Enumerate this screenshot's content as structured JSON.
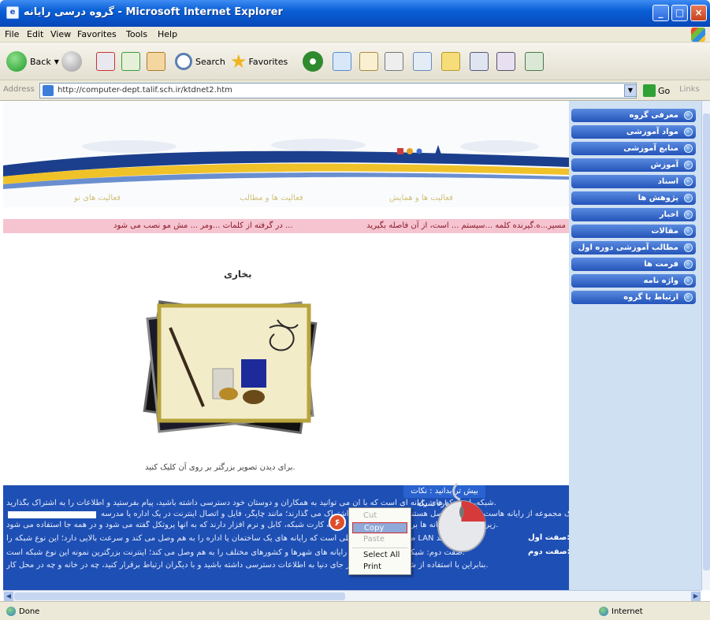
{
  "window": {
    "title": "گروه درسی رایانه - Microsoft Internet Explorer",
    "icon": "ie-page-icon",
    "controls": [
      "minimize",
      "maximize",
      "close"
    ]
  },
  "menubar": [
    "File",
    "Edit",
    "View",
    "Favorites",
    "Tools",
    "Help"
  ],
  "toolbar": {
    "back_label": "Back",
    "search_label": "Search",
    "favorites_label": "Favorites"
  },
  "addressbar": {
    "label": "Address",
    "url": "http://computer-dept.talif.sch.ir/ktdnet2.htm",
    "go_label": "Go",
    "links_label": "Links"
  },
  "banner_links": [
    "فعالیت ها و همایش",
    "فعالیت ها و مطالب",
    "فعالیت های نو"
  ],
  "marquee": {
    "text_right": "مسیر...ه.گیرنده کلمه ...سیستم ... است، از آن فاصله بگیرید",
    "text_left": "در گرفته از کلمات ...ومر ... مش مو نصب می شود ..."
  },
  "heading": "بخاری",
  "caption": "برای دیدن تصویر بزرگتر بر روی آن کلیک کنید.",
  "article": {
    "title": "بیش تر بدانید : نکات مهم درباره شبکه",
    "lines": [
      "شبکه، از شبکه های رایانه ای است که با آن می توانید به همکاران و دوستان خود دسترسی داشته باشید، پیام بفرستید و اطلاعات را به اشتراک بگذارید.",
      "شبکه یک مجموعه از رایانه هاست که به هم متصل هستند و منابع خود را به اشتراک می گذارند؛ مانند چاپگر، فایل و اتصال اینترنت در یک اداره یا مدرسه.",
      "زیر برگ گفت: رایانه ها برای ارتباط با یکدیگر نیاز به کارت شبکه، کابل و نرم افزار دارند که به آنها پروتکل گفته می شود و در همه جا استفاده می شود.",
      "صفت اول: شبکه محلی است که رایانه های یک ساختمان یا اداره را به هم وصل می کند و سرعت بالایی دارد؛ این نوع شبکه را LAN می نامند.",
      "صفت دوم: شبکه گسترده است که رایانه های شهرها و کشورهای مختلف را به هم وصل می کند؛ اینترنت بزرگترین نمونه این نوع شبکه است.",
      "بنابراین با استفاده از شبکه می توانید از هر جای دنیا به اطلاعات دسترسی داشته باشید و با دیگران ارتباط برقرار کنید، چه در خانه و چه در محل کار."
    ],
    "bold_1": "صفت اول:",
    "bold_2": "صفت دوم:"
  },
  "context_menu": {
    "items": [
      {
        "label": "Cut",
        "enabled": false
      },
      {
        "label": "Copy",
        "enabled": true,
        "highlighted": true
      },
      {
        "label": "Paste",
        "enabled": false
      },
      {
        "label": "Select All",
        "enabled": true
      },
      {
        "label": "Print",
        "enabled": true
      }
    ]
  },
  "step_number": "۶",
  "sidebar": {
    "items": [
      "معرفی گروه",
      "مواد آموزشی",
      "منابع آموزشی",
      "آموزش",
      "اسناد",
      "پژوهش ها",
      "اخبار",
      "مقالات",
      "مطالب آموزشی دوره اول",
      "فرمت ها",
      "واژه نامه",
      "ارتباط با گروه"
    ]
  },
  "status": {
    "left": "Done",
    "zone": "Internet"
  },
  "colors": {
    "titlebar": "#0a5fd6",
    "sidebar_button": "#2454b9",
    "article_bg": "#1e4fb4",
    "marquee_bg": "#f6c4d0"
  }
}
